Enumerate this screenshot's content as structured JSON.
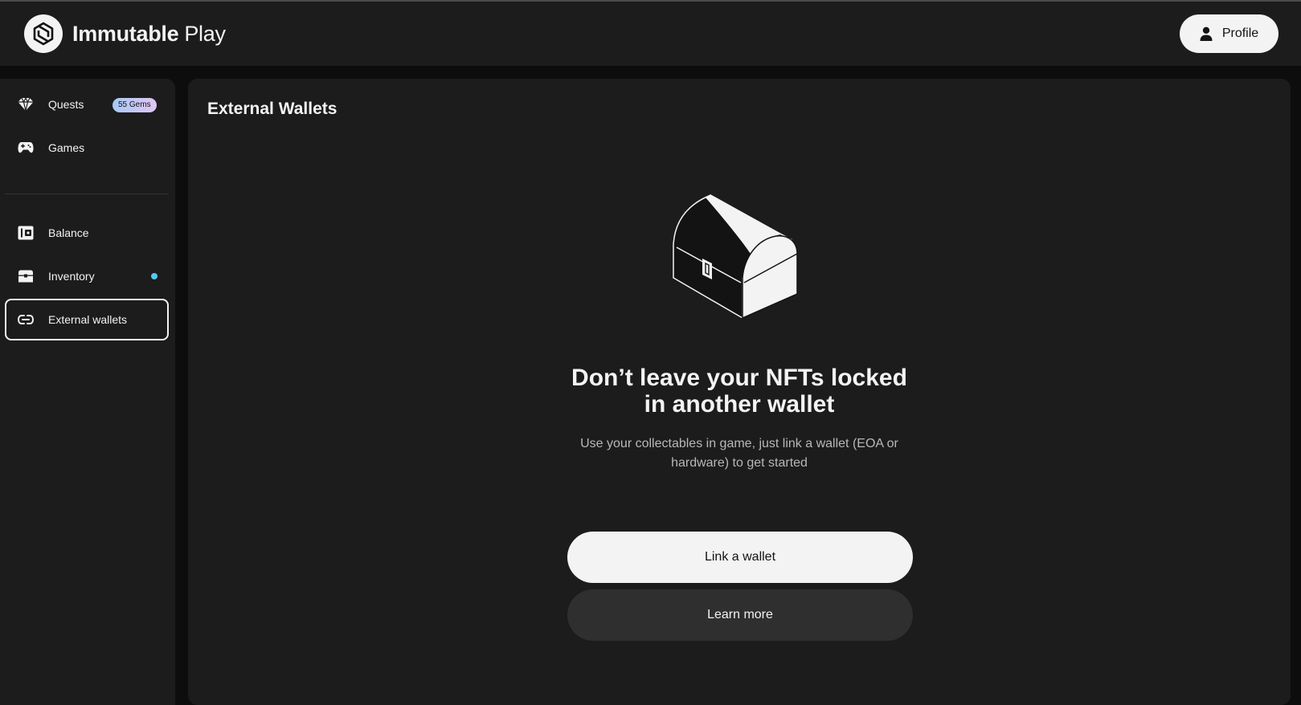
{
  "header": {
    "brand_bold": "Immutable",
    "brand_light": "Play",
    "logo_icon": "immutable-logo-icon",
    "profile_label": "Profile",
    "profile_icon": "user-icon"
  },
  "sidebar": {
    "items": [
      {
        "label": "Quests",
        "icon": "gem-icon",
        "badge": "55 Gems"
      },
      {
        "label": "Games",
        "icon": "gamepad-icon"
      },
      {
        "label": "Balance",
        "icon": "wallet-icon"
      },
      {
        "label": "Inventory",
        "icon": "chest-icon",
        "has_dot": true
      },
      {
        "label": "External wallets",
        "icon": "link-icon",
        "active": true
      }
    ]
  },
  "main": {
    "title": "External Wallets",
    "illustration": "treasure-chest-illustration",
    "headline_line1": "Don’t leave your NFTs locked",
    "headline_line2": "in another wallet",
    "subtext_line1": "Use your collectables in game, just link a wallet (EOA or",
    "subtext_line2": "hardware) to get started",
    "primary_button": "Link a wallet",
    "secondary_button": "Learn more"
  },
  "colors": {
    "background": "#0d0d0d",
    "panel": "#1c1c1c",
    "text": "#f3f3f3",
    "muted_text": "#b8b8b8",
    "secondary_button": "#2f2f2f",
    "notification_dot": "#55c7f0"
  }
}
